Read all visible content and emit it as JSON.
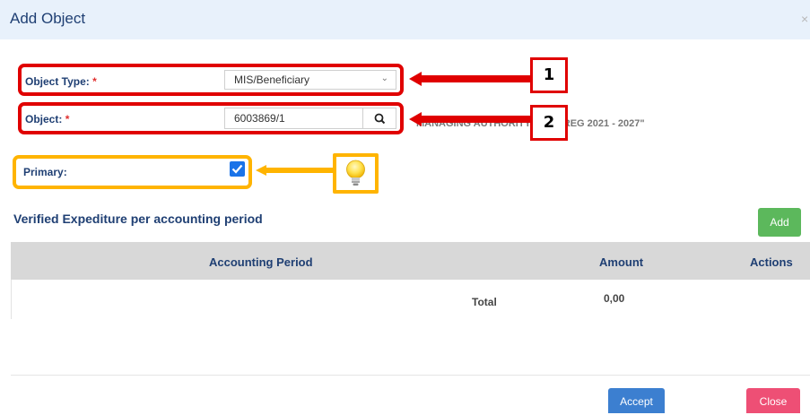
{
  "dialog": {
    "title": "Add Object",
    "close_glyph": "×"
  },
  "form": {
    "object_type": {
      "label": "Object Type:",
      "required_mark": "*",
      "value": "MIS/Beneficiary"
    },
    "object": {
      "label": "Object:",
      "required_mark": "*",
      "value": "6003869/1",
      "description": "MANAGING AUTHORITY INTERREG 2021 - 2027\""
    },
    "primary": {
      "label": "Primary:",
      "checked": true
    }
  },
  "annotations": {
    "callout_1": "1",
    "callout_2": "2",
    "red_color": "#e00000",
    "orange_color": "#ffb400",
    "bulb_icon": "lightbulb-icon"
  },
  "section": {
    "title": "Verified Expediture per accounting period",
    "add_label": "Add"
  },
  "table": {
    "columns": [
      "Accounting Period",
      "Amount",
      "Actions"
    ],
    "total_label": "Total",
    "total_amount": "0,00"
  },
  "footer": {
    "accept_label": "Accept",
    "close_label": "Close"
  },
  "colors": {
    "header_bg": "#e8f1fb",
    "title": "#1f3f73",
    "add": "#5cb85c",
    "accept": "#3c7fd0",
    "close": "#ee4f75",
    "checkbox": "#1a73e8"
  }
}
